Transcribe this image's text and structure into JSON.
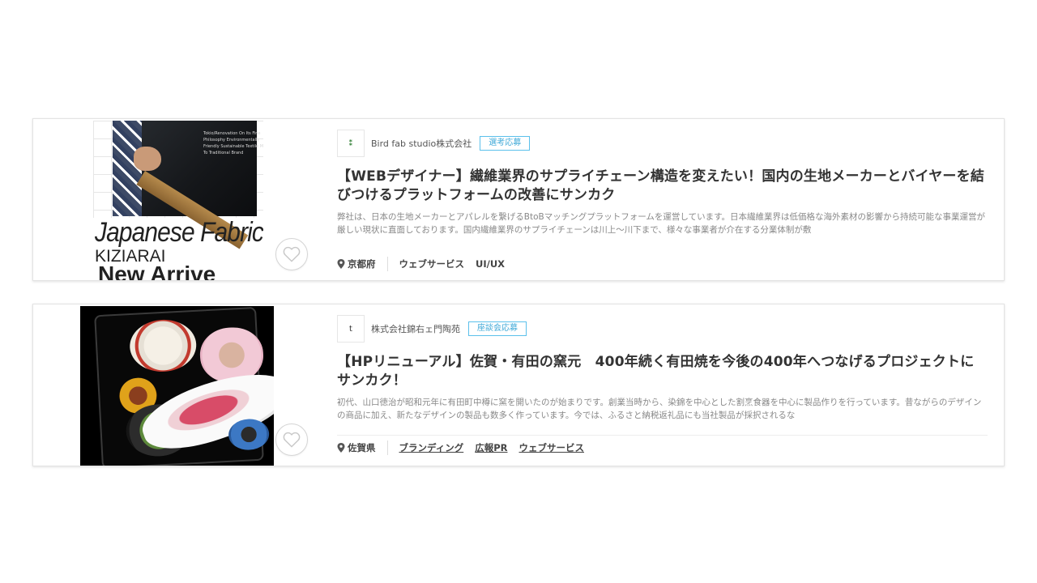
{
  "cards": [
    {
      "thumbnail": {
        "big_text": "Japanese Fabric",
        "mid_text": "KIZIARAI",
        "bottom_text": "New Arrive",
        "caption": "Tokio/Renovation On Its Fine Philosophy Environmentally Friendly Sustainable Textile Maker To Traditional Brand"
      },
      "company": "Bird fab studio株式会社",
      "logo_text": "⁑",
      "badge": "選考応募",
      "title": "【WEBデザイナー】繊維業界のサプライチェーン構造を変えたい！国内の生地メーカーとバイヤーを結びつけるプラットフォームの改善にサンカク",
      "description": "弊社は、日本の生地メーカーとアパレルを繋げるBtoBマッチングプラットフォームを運営しています。日本繊維業界は低価格な海外素材の影響から持続可能な事業運営が厳しい現状に直面しております。国内繊維業界のサプライチェーンは川上〜川下まで、様々な事業者が介在する分業体制が敷",
      "location": "京都府",
      "tags": [
        "ウェブサービス",
        "UI/UX"
      ]
    },
    {
      "company": "株式会社錦右ェ門陶苑",
      "logo_text": "t",
      "badge": "座談会応募",
      "title": "【HPリニューアル】佐賀・有田の窯元　400年続く有田焼を今後の400年へつなげるプロジェクトにサンカク！",
      "description": "初代、山口徳治が昭和元年に有田町中樽に窯を開いたのが始まりです。創業当時から、染錦を中心とした割烹食器を中心に製品作りを行っています。昔ながらのデザインの商品に加え、新たなデザインの製品も数多く作っています。今では、ふるさと納税返礼品にも当社製品が採択されるな",
      "location": "佐賀県",
      "tags": [
        "ブランディング",
        "広報PR",
        "ウェブサービス"
      ]
    }
  ],
  "colors": {
    "badge": "#3fa9d8",
    "title": "#333333",
    "description": "#888888"
  },
  "icons": [
    "heart-icon",
    "location-pin-icon"
  ]
}
